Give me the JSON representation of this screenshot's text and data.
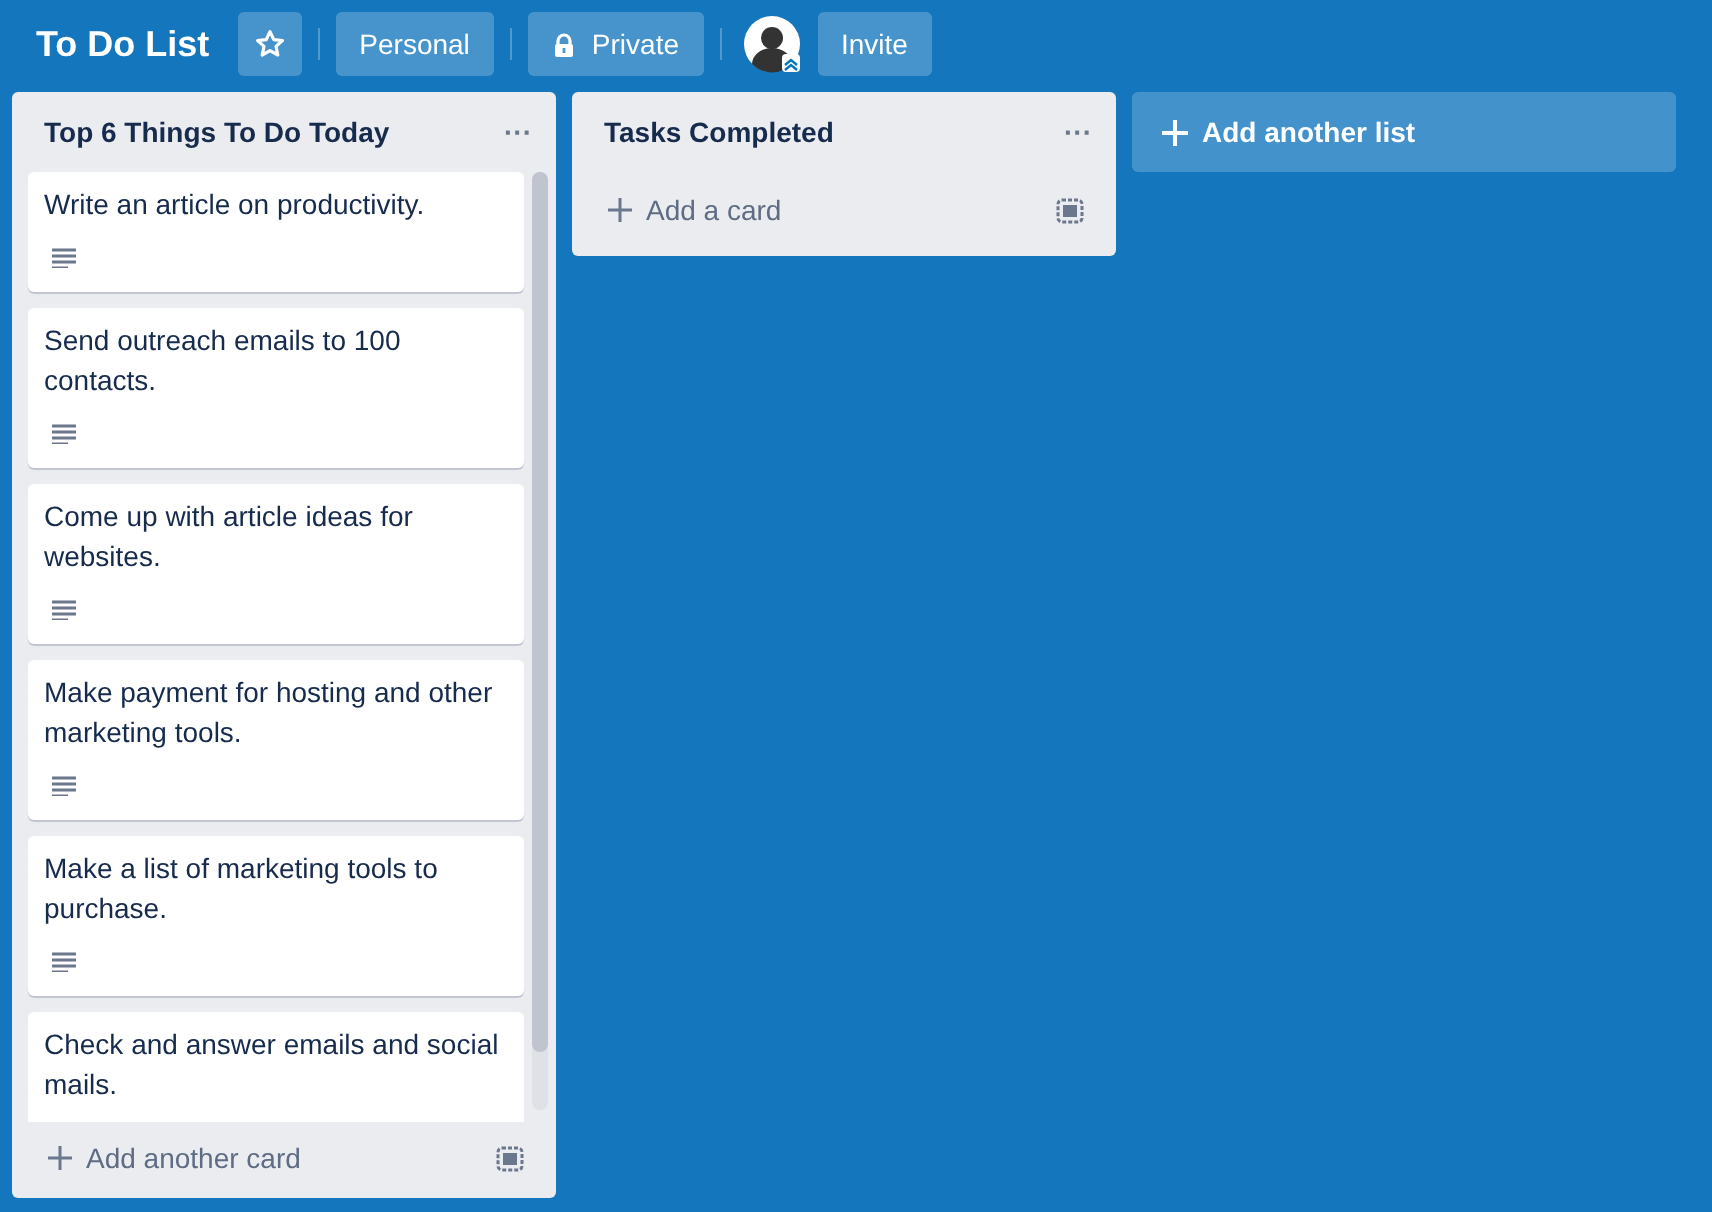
{
  "board": {
    "title": "To Do List",
    "starred": false,
    "team": "Personal",
    "visibility": "Private",
    "invite": "Invite"
  },
  "lists": [
    {
      "title": "Top 6 Things To Do Today",
      "menu": "···",
      "add": "Add another card",
      "cards": [
        {
          "text": "Write an article on productivity.",
          "description": true
        },
        {
          "text": "Send outreach emails to 100 contacts.",
          "description": true
        },
        {
          "text": "Come up with article ideas for websites.",
          "description": true
        },
        {
          "text": "Make payment for hosting and other marketing tools.",
          "description": true
        },
        {
          "text": "Make a list of marketing tools to purchase.",
          "description": true
        },
        {
          "text": "Check and answer emails and social mails."
        }
      ]
    },
    {
      "title": "Tasks Completed",
      "menu": "···",
      "add": "Add a card"
    }
  ],
  "add_list": "Add another list"
}
